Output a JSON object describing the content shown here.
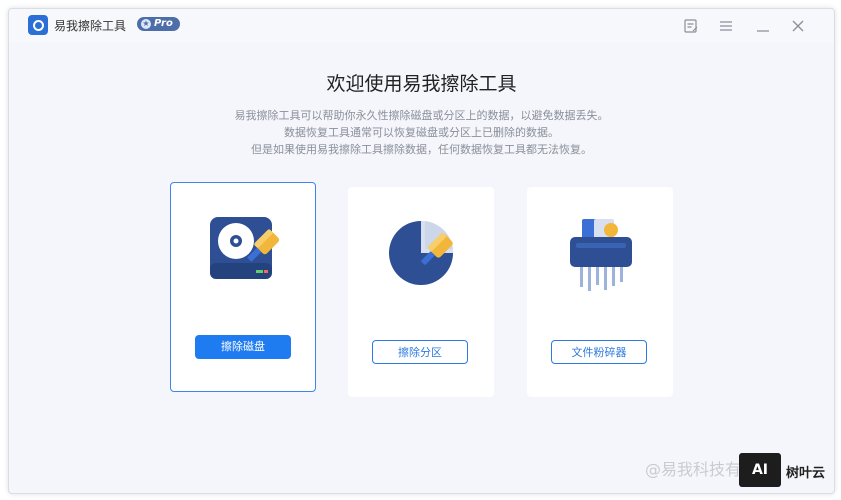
{
  "app": {
    "title": "易我擦除工具",
    "badge": "Pro",
    "icon": "eraser-app-logo"
  },
  "window_controls": [
    {
      "name": "feedback-icon"
    },
    {
      "name": "menu-icon"
    },
    {
      "name": "minimize-icon"
    },
    {
      "name": "close-icon"
    }
  ],
  "main": {
    "heading": "欢迎使用易我擦除工具",
    "description": [
      "易我擦除工具可以帮助你永久性擦除磁盘或分区上的数据，以避免数据丢失。",
      "数据恢复工具通常可以恢复磁盘或分区上已删除的数据。",
      "但是如果使用易我擦除工具擦除数据，任何数据恢复工具都无法恢复。"
    ]
  },
  "cards": [
    {
      "label": "擦除磁盘",
      "icon": "disk-eraser-icon",
      "selected": true
    },
    {
      "label": "擦除分区",
      "icon": "partition-eraser-icon",
      "selected": false
    },
    {
      "label": "文件粉碎器",
      "icon": "file-shredder-icon",
      "selected": false
    }
  ],
  "watermark": {
    "text": "@易我科技有限",
    "ai_badge": "AI",
    "brand": "树叶云"
  },
  "colors": {
    "accent": "#1e7bf0",
    "disk_blue": "#2e4f93",
    "brush_yellow": "#f2b63b",
    "background": "#f4f6fb"
  }
}
